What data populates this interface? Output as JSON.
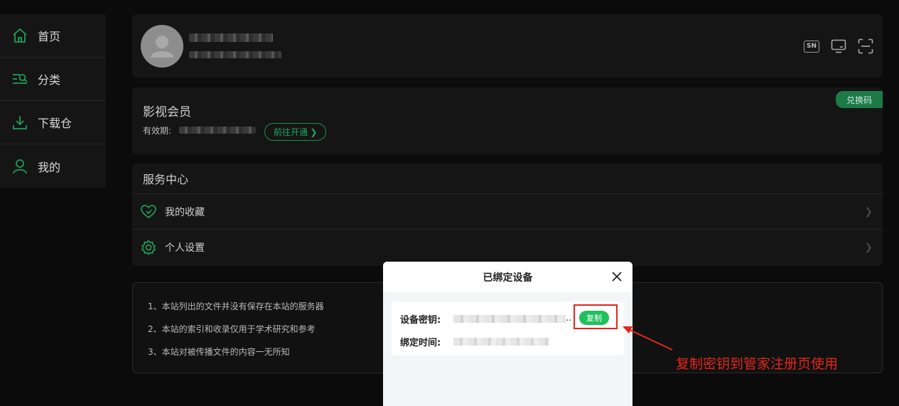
{
  "sidebar": {
    "items": [
      {
        "label": "首页",
        "icon": "home-icon"
      },
      {
        "label": "分类",
        "icon": "category-icon"
      },
      {
        "label": "下载仓",
        "icon": "download-icon"
      },
      {
        "label": "我的",
        "icon": "user-icon"
      }
    ]
  },
  "profile": {
    "icons": [
      "sn-icon",
      "tv-icon",
      "scan-icon"
    ],
    "sn_label": "SN"
  },
  "vip": {
    "title": "影视会员",
    "validity_label": "有效期:",
    "open_label": "前往开通 ❯",
    "redeem_label": "兑换码"
  },
  "service": {
    "title": "服务中心",
    "items": [
      {
        "label": "我的收藏",
        "icon": "heart-icon"
      },
      {
        "label": "个人设置",
        "icon": "settings-gear-icon"
      }
    ]
  },
  "notice": {
    "lines": [
      "1、本站列出的文件并没有保存在本站的服务器",
      "2、本站的索引和收录仅用于学术研究和参考",
      "3、本站对被传播文件的内容一无所知"
    ]
  },
  "modal": {
    "title": "已绑定设备",
    "key_label": "设备密钥:",
    "key_suffix": "..",
    "copy_label": "复制",
    "time_label": "绑定时间:"
  },
  "annotation": {
    "text": "复制密钥到管家注册页使用",
    "color": "#e3261c"
  },
  "colors": {
    "accent": "#1fa85c",
    "copy_button": "#20c05c"
  }
}
